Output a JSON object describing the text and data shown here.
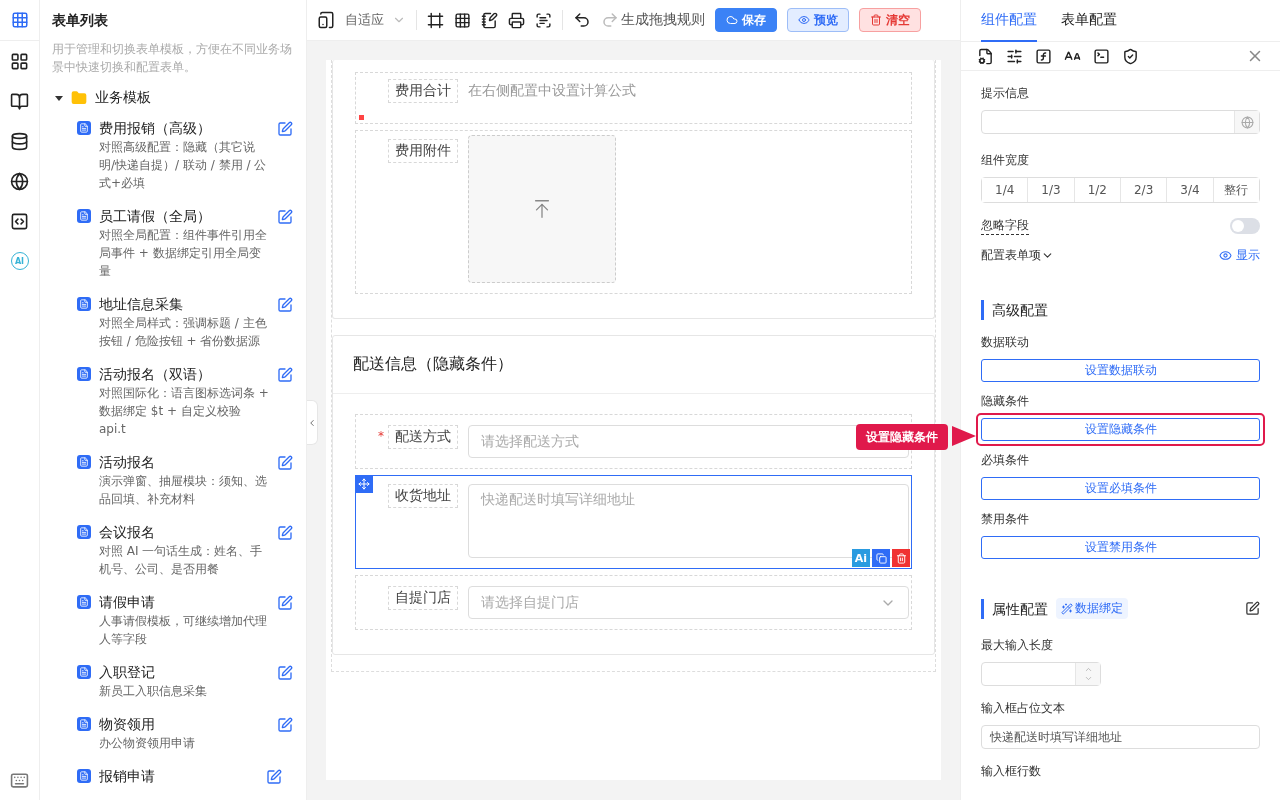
{
  "rail": {
    "ai_badge": "AI"
  },
  "sidebar": {
    "title": "表单列表",
    "description": "用于管理和切换表单模板，方便在不同业务场景中快速切换和配置表单。",
    "folder": {
      "label": "业务模板",
      "expanded": true,
      "children": [
        {
          "title": "费用报销（高级）",
          "desc": "对照高级配置：隐藏（其它说明/快递自提）/ 联动 / 禁用 / 公式+必填"
        },
        {
          "title": "员工请假（全局）",
          "desc": "对照全局配置：组件事件引用全局事件 + 数据绑定引用全局变量"
        },
        {
          "title": "地址信息采集",
          "desc": "对照全局样式：强调标题 / 主色按钮 / 危险按钮 + 省份数据源"
        },
        {
          "title": "活动报名（双语）",
          "desc": "对照国际化：语言图标选词条 + 数据绑定 $t + 自定义校验 api.t"
        },
        {
          "title": "活动报名",
          "desc": "演示弹窗、抽屉模块：须知、选品回填、补充材料"
        },
        {
          "title": "会议报名",
          "desc": "对照 AI 一句话生成：姓名、手机号、公司、是否用餐"
        },
        {
          "title": "请假申请",
          "desc": "人事请假模板，可继续增加代理人等字段"
        },
        {
          "title": "入职登记",
          "desc": "新员工入职信息采集"
        },
        {
          "title": "物资领用",
          "desc": "办公物资领用申请"
        },
        {
          "title": "报销申请"
        }
      ]
    }
  },
  "toolbar": {
    "device": "自适应",
    "undo": {
      "disabled": false
    },
    "redo": {
      "disabled": true
    },
    "generate_rule": "生成拖拽规则",
    "buttons": [
      {
        "label": "保存",
        "kind": "primary"
      },
      {
        "label": "预览",
        "kind": "preview"
      },
      {
        "label": "清空",
        "kind": "danger"
      }
    ]
  },
  "canvas": {
    "sections": [
      {
        "fields": [
          {
            "kind": "formula",
            "label": "费用合计",
            "hint": "在右侧配置中设置计算公式"
          },
          {
            "kind": "upload",
            "label": "费用附件"
          }
        ]
      },
      {
        "title": "配送信息（隐藏条件）",
        "fields": [
          {
            "kind": "select",
            "label": "配送方式",
            "required_mark": "*",
            "placeholder": "请选择配送方式",
            "selected": false
          },
          {
            "kind": "textarea",
            "label": "收货地址",
            "placeholder": "快递配送时填写详细地址",
            "selected": true,
            "ai_label": "Ai"
          },
          {
            "kind": "select",
            "label": "自提门店",
            "placeholder": "请选择自提门店",
            "selected": false,
            "chevron": true
          }
        ]
      }
    ]
  },
  "callout": {
    "text": "设置隐藏条件"
  },
  "panel": {
    "tabs": [
      {
        "label": "组件配置",
        "selected": true
      },
      {
        "label": "表单配置",
        "selected": false
      }
    ],
    "tip_label": "提示信息",
    "width_label": "组件宽度",
    "width_options": [
      {
        "label": "1/4",
        "selected": false
      },
      {
        "label": "1/3",
        "selected": false
      },
      {
        "label": "1/2",
        "selected": false
      },
      {
        "label": "2/3",
        "selected": false
      },
      {
        "label": "3/4",
        "selected": false
      },
      {
        "label": "整行",
        "selected": false
      }
    ],
    "ignore": {
      "label": "忽略字段",
      "on": false
    },
    "form_items": {
      "label": "配置表单项",
      "link": "显示"
    },
    "advanced": {
      "title": "高级配置",
      "conditions": [
        {
          "label": "数据联动",
          "button": "设置数据联动",
          "highlighted": false
        },
        {
          "label": "隐藏条件",
          "button": "设置隐藏条件",
          "highlighted": true
        },
        {
          "label": "必填条件",
          "button": "设置必填条件",
          "highlighted": false
        },
        {
          "label": "禁用条件",
          "button": "设置禁用条件",
          "highlighted": false
        }
      ]
    },
    "props": {
      "title": "属性配置",
      "tag": "数据绑定",
      "max_length_label": "最大输入长度",
      "placeholder_label": "输入框占位文本",
      "placeholder_value": "快递配送时填写详细地址",
      "rows_label": "输入框行数"
    }
  }
}
